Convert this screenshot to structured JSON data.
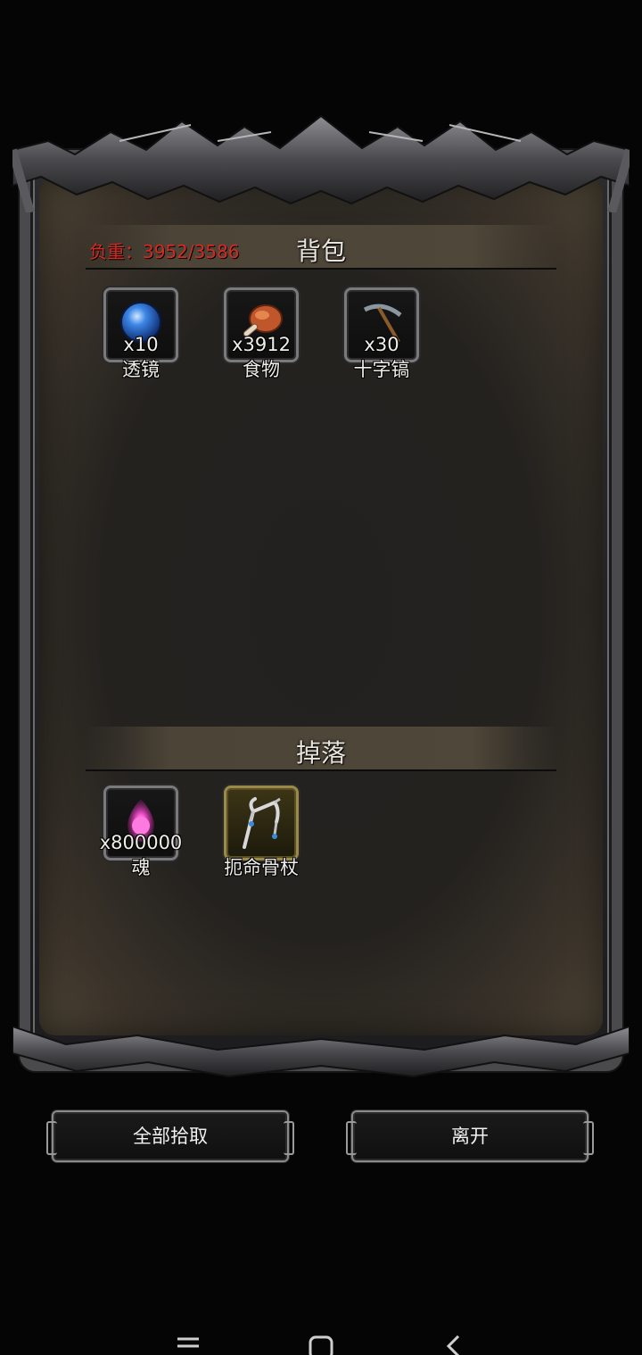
{
  "bag": {
    "title": "背包",
    "weight": "负重：3952/3586",
    "items": [
      {
        "count": "x10",
        "name": "透镜",
        "icon": "blue-orb-lens-icon"
      },
      {
        "count": "x3912",
        "name": "食物",
        "icon": "meat-drumstick-icon"
      },
      {
        "count": "x30",
        "name": "十字镐",
        "icon": "pickaxe-icon"
      }
    ]
  },
  "drop": {
    "title": "掉落",
    "items": [
      {
        "count": "x800000",
        "name": "魂",
        "icon": "pink-soul-flame-icon"
      },
      {
        "count": "",
        "name": "扼命骨杖",
        "icon": "bone-staff-icon"
      }
    ]
  },
  "buttons": {
    "pickup_all": "全部拾取",
    "leave": "离开"
  },
  "navbar": {
    "icons": [
      "recent-apps-icon",
      "home-icon",
      "back-icon"
    ]
  },
  "colors": {
    "weight_warning": "#d42a22",
    "text": "#f0eee8",
    "header_bar": "#4f4739",
    "rare_slot_border": "#9a8a4a"
  }
}
